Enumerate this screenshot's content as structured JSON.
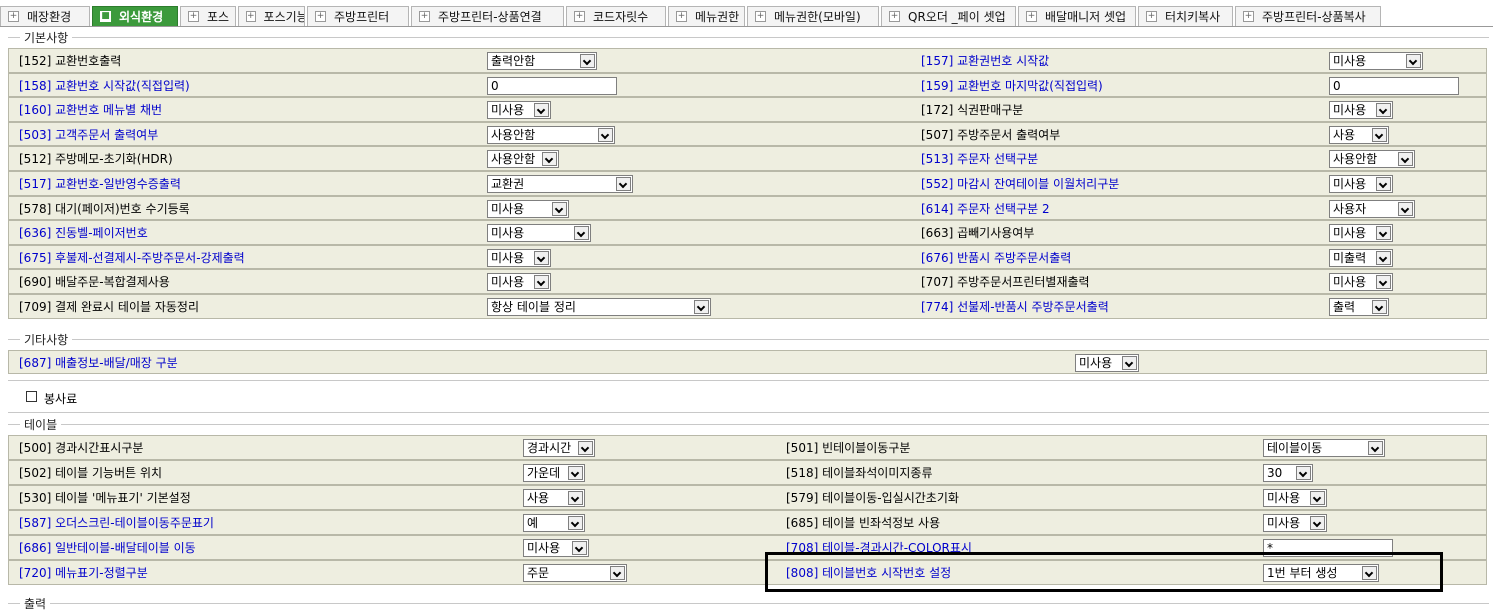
{
  "tabs": [
    {
      "label": "매장환경",
      "active": false
    },
    {
      "label": "외식환경",
      "active": true
    },
    {
      "label": "포스",
      "active": false
    },
    {
      "label": "포스기능",
      "active": false
    },
    {
      "label": "주방프린터",
      "active": false
    },
    {
      "label": "주방프린터-상품연결",
      "active": false
    },
    {
      "label": "코드자릿수",
      "active": false
    },
    {
      "label": "메뉴권한",
      "active": false
    },
    {
      "label": "메뉴권한(모바일)",
      "active": false
    },
    {
      "label": "QR오더 _페이 셋업",
      "active": false
    },
    {
      "label": "배달매니저 셋업",
      "active": false
    },
    {
      "label": "터치키복사",
      "active": false
    },
    {
      "label": "주방프린터-상품복사",
      "active": false
    }
  ],
  "sections": {
    "basic": "기본사항",
    "etc": "기타사항",
    "service_charge": "봉사료",
    "table": "테이블",
    "output": "출력"
  },
  "basic_rows": [
    {
      "l_label": "[152] 교환번호출력",
      "l_blue": false,
      "l_ctrl": "select",
      "l_value": "출력안함",
      "r_label": "[157] 교환권번호 시작값",
      "r_blue": true,
      "r_ctrl": "select",
      "r_value": "미사용"
    },
    {
      "l_label": "[158] 교환번호 시작값(직접입력)",
      "l_blue": true,
      "l_ctrl": "input",
      "l_value": "0",
      "r_label": "[159] 교환번호 마지막값(직접입력)",
      "r_blue": true,
      "r_ctrl": "input",
      "r_value": "0"
    },
    {
      "l_label": "[160] 교환번호 메뉴별 채번",
      "l_blue": true,
      "l_ctrl": "select",
      "l_value": "미사용",
      "r_label": "[172] 식권판매구분",
      "r_blue": false,
      "r_ctrl": "select",
      "r_value": "미사용"
    },
    {
      "l_label": "[503] 고객주문서 출력여부",
      "l_blue": true,
      "l_ctrl": "select",
      "l_value": "사용안함",
      "r_label": "[507] 주방주문서 출력여부",
      "r_blue": false,
      "r_ctrl": "select",
      "r_value": "사용"
    },
    {
      "l_label": "[512] 주방메모-초기화(HDR)",
      "l_blue": false,
      "l_ctrl": "select",
      "l_value": "사용안함",
      "r_label": "[513] 주문자 선택구분",
      "r_blue": true,
      "r_ctrl": "select",
      "r_value": "사용안함"
    },
    {
      "l_label": "[517] 교환번호-일반영수증출력",
      "l_blue": true,
      "l_ctrl": "select",
      "l_value": "교환권",
      "r_label": "[552] 마감시 잔여테이블 이월처리구분",
      "r_blue": true,
      "r_ctrl": "select",
      "r_value": "미사용"
    },
    {
      "l_label": "[578] 대기(페이저)번호 수기등록",
      "l_blue": false,
      "l_ctrl": "select",
      "l_value": "미사용",
      "r_label": "[614] 주문자 선택구분 2",
      "r_blue": true,
      "r_ctrl": "select",
      "r_value": "사용자"
    },
    {
      "l_label": "[636] 진동벨-페이저번호",
      "l_blue": true,
      "l_ctrl": "select",
      "l_value": "미사용",
      "r_label": "[663] 곱빼기사용여부",
      "r_blue": false,
      "r_ctrl": "select",
      "r_value": "미사용"
    },
    {
      "l_label": "[675] 후불제-선결제시-주방주문서-강제출력",
      "l_blue": true,
      "l_ctrl": "select",
      "l_value": "미사용",
      "r_label": "[676] 반품시 주방주문서출력",
      "r_blue": true,
      "r_ctrl": "select",
      "r_value": "미출력"
    },
    {
      "l_label": "[690] 배달주문-복합결제사용",
      "l_blue": false,
      "l_ctrl": "select",
      "l_value": "미사용",
      "r_label": "[707] 주방주문서프린터별재출력",
      "r_blue": false,
      "r_ctrl": "select",
      "r_value": "미사용"
    },
    {
      "l_label": "[709] 결제 완료시 테이블 자동정리",
      "l_blue": false,
      "l_ctrl": "select",
      "l_value": "항상 테이블 정리",
      "r_label": "[774] 선불제-반품시 주방주문서출력",
      "r_blue": true,
      "r_ctrl": "select",
      "r_value": "출력"
    }
  ],
  "etc_rows": [
    {
      "l_label": "[687] 매출정보-배달/매장 구분",
      "l_blue": true,
      "l_ctrl": "select",
      "l_value": "미사용"
    }
  ],
  "table_rows": [
    {
      "l_label": "[500] 경과시간표시구분",
      "l_blue": false,
      "l_ctrl": "select",
      "l_value": "경과시간",
      "r_label": "[501] 빈테이블이동구분",
      "r_blue": false,
      "r_ctrl": "select",
      "r_value": "테이블이동"
    },
    {
      "l_label": "[502] 테이블 기능버튼 위치",
      "l_blue": false,
      "l_ctrl": "select",
      "l_value": "가운데",
      "r_label": "[518] 테이블좌석이미지종류",
      "r_blue": false,
      "r_ctrl": "select",
      "r_value": "30"
    },
    {
      "l_label": "[530] 테이블 '메뉴표기' 기본설정",
      "l_blue": false,
      "l_ctrl": "select",
      "l_value": "사용",
      "r_label": "[579] 테이블이동-입실시간초기화",
      "r_blue": false,
      "r_ctrl": "select",
      "r_value": "미사용"
    },
    {
      "l_label": "[587] 오더스크린-테이블이동주문표기",
      "l_blue": true,
      "l_ctrl": "select",
      "l_value": "예",
      "r_label": "[685] 테이블 빈좌석정보 사용",
      "r_blue": false,
      "r_ctrl": "select",
      "r_value": "미사용"
    },
    {
      "l_label": "[686] 일반테이블-배달테이블 이동",
      "l_blue": true,
      "l_ctrl": "select",
      "l_value": "미사용",
      "r_label": "[708] 테이블-경과시간-COLOR표시",
      "r_blue": true,
      "r_ctrl": "input",
      "r_value": "*"
    },
    {
      "l_label": "[720] 메뉴표기-정렬구분",
      "l_blue": true,
      "l_ctrl": "select",
      "l_value": "주문",
      "r_label": "[808] 테이블번호 시작번호 설정",
      "r_blue": true,
      "r_ctrl": "select",
      "r_value": "1번 부터 생성"
    }
  ],
  "colors": {
    "row_bg": "#eeeee0",
    "link_blue": "#0000cc",
    "active_tab": "#3c9a3c"
  }
}
